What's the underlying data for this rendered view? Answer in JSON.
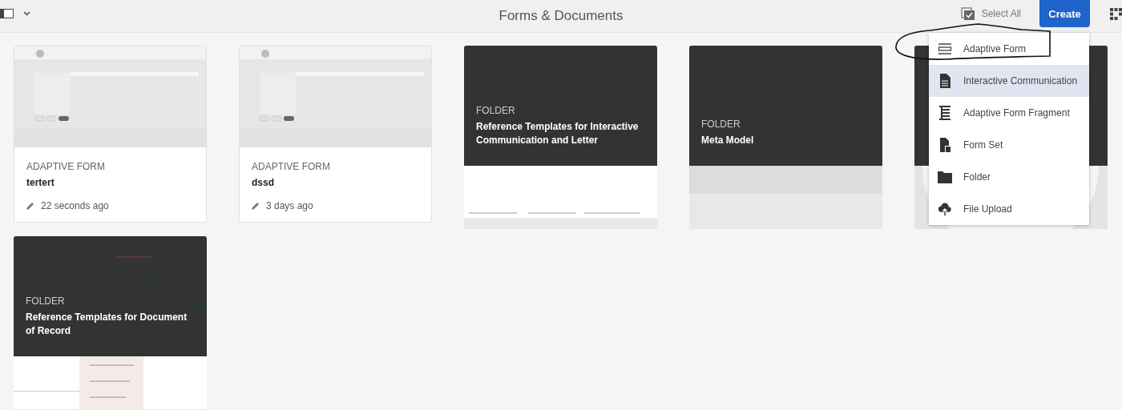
{
  "toolbar": {
    "title": "Forms & Documents",
    "select_all": "Select All",
    "create_button": "Create"
  },
  "cards": [
    {
      "kind": "form",
      "type_label": "ADAPTIVE FORM",
      "title": "tertert",
      "modified": "22 seconds ago"
    },
    {
      "kind": "form",
      "type_label": "ADAPTIVE FORM",
      "title": "dssd",
      "modified": "3 days ago"
    },
    {
      "kind": "folder",
      "type_label": "FOLDER",
      "title": "Reference Templates for Interactive Communication and Letter"
    },
    {
      "kind": "folder",
      "type_label": "FOLDER",
      "title": "Meta Model"
    },
    {
      "kind": "folder"
    },
    {
      "kind": "folder",
      "type_label": "FOLDER",
      "title": "Reference Templates for Document of Record"
    }
  ],
  "create_menu": [
    {
      "kind": "form",
      "label": "Adaptive Form",
      "selected": false
    },
    {
      "kind": "document",
      "label": "Interactive Communication",
      "selected": true
    },
    {
      "kind": "fragment",
      "label": "Adaptive Form Fragment",
      "selected": false
    },
    {
      "kind": "formset",
      "label": "Form Set",
      "selected": false
    },
    {
      "kind": "folder",
      "label": "Folder",
      "selected": false
    },
    {
      "kind": "upload",
      "label": "File Upload",
      "selected": false
    }
  ]
}
